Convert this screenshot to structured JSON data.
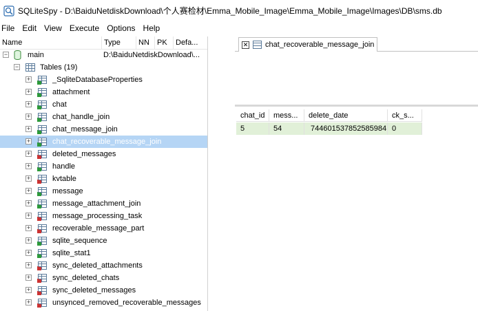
{
  "window": {
    "app_icon": "sqlitespy-icon",
    "title": "SQLiteSpy - D:\\BaiduNetdiskDownload\\个人赛检材\\Emma_Mobile_Image\\Emma_Mobile_Image\\Images\\DB\\sms.db"
  },
  "menu": [
    {
      "label": "File"
    },
    {
      "label": "Edit"
    },
    {
      "label": "View"
    },
    {
      "label": "Execute"
    },
    {
      "label": "Options"
    },
    {
      "label": "Help"
    }
  ],
  "schema": {
    "columns": [
      "Name",
      "Type",
      "NN",
      "PK",
      "Defa..."
    ],
    "db_label": "main",
    "db_path": "D:\\BaiduNetdiskDownload\\...",
    "tables_label": "Tables (19)",
    "tables": [
      {
        "name": "_SqliteDatabaseProperties",
        "badge": "green"
      },
      {
        "name": "attachment",
        "badge": "green"
      },
      {
        "name": "chat",
        "badge": "green"
      },
      {
        "name": "chat_handle_join",
        "badge": "green"
      },
      {
        "name": "chat_message_join",
        "badge": "green"
      },
      {
        "name": "chat_recoverable_message_join",
        "badge": "green"
      },
      {
        "name": "deleted_messages",
        "badge": "red"
      },
      {
        "name": "handle",
        "badge": "green"
      },
      {
        "name": "kvtable",
        "badge": "red"
      },
      {
        "name": "message",
        "badge": "green"
      },
      {
        "name": "message_attachment_join",
        "badge": "green"
      },
      {
        "name": "message_processing_task",
        "badge": "red"
      },
      {
        "name": "recoverable_message_part",
        "badge": "red"
      },
      {
        "name": "sqlite_sequence",
        "badge": "green"
      },
      {
        "name": "sqlite_stat1",
        "badge": "green"
      },
      {
        "name": "sync_deleted_attachments",
        "badge": "red"
      },
      {
        "name": "sync_deleted_chats",
        "badge": "red"
      },
      {
        "name": "sync_deleted_messages",
        "badge": "red"
      },
      {
        "name": "unsynced_removed_recoverable_messages",
        "badge": "red"
      }
    ],
    "selected_table": "chat_recoverable_message_join"
  },
  "editor": {
    "tab_label": "chat_recoverable_message_join",
    "sql_text": ""
  },
  "result": {
    "columns": [
      "chat_id",
      "mess...",
      "delete_date",
      "ck_s..."
    ],
    "rows": [
      [
        "5",
        "54",
        "744601537852585984",
        "0"
      ]
    ]
  }
}
